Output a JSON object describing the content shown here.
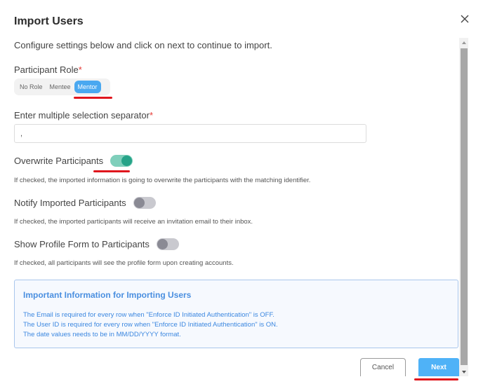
{
  "dialog": {
    "title": "Import Users",
    "intro": "Configure settings below and click on next to continue to import."
  },
  "participant_role": {
    "label": "Participant Role",
    "required_mark": "*",
    "options": [
      "No Role",
      "Mentee",
      "Mentor"
    ],
    "selected": "Mentor"
  },
  "separator": {
    "label": "Enter multiple selection separator",
    "required_mark": "*",
    "value": ","
  },
  "toggles": [
    {
      "label": "Overwrite Participants",
      "checked": true,
      "help": "If checked, the imported information is going to overwrite the participants with the matching identifier."
    },
    {
      "label": "Notify Imported Participants",
      "checked": false,
      "help": "If checked, the imported participants will receive an invitation email to their inbox."
    },
    {
      "label": "Show Profile Form to Participants",
      "checked": false,
      "help": "If checked, all participants will see the profile form upon creating accounts."
    }
  ],
  "info": {
    "title": "Important Information for Importing Users",
    "lines": [
      "The Email is required for every row when \"Enforce ID Initiated Authentication\" is OFF.",
      "The User ID is required for every row when \"Enforce ID Initiated Authentication\" is ON.",
      "The date values needs to be in MM/DD/YYYY format."
    ]
  },
  "buttons": {
    "cancel": "Cancel",
    "next": "Next"
  },
  "icons": {
    "close": "close-icon",
    "scroll_up": "scroll-up-arrow-icon",
    "scroll_down": "scroll-down-arrow-icon"
  },
  "colors": {
    "primary": "#4fb2f7",
    "toggle_on": "#26a388",
    "info_text": "#3b87e0",
    "annotation": "#e0161d",
    "required": "#e53935"
  }
}
